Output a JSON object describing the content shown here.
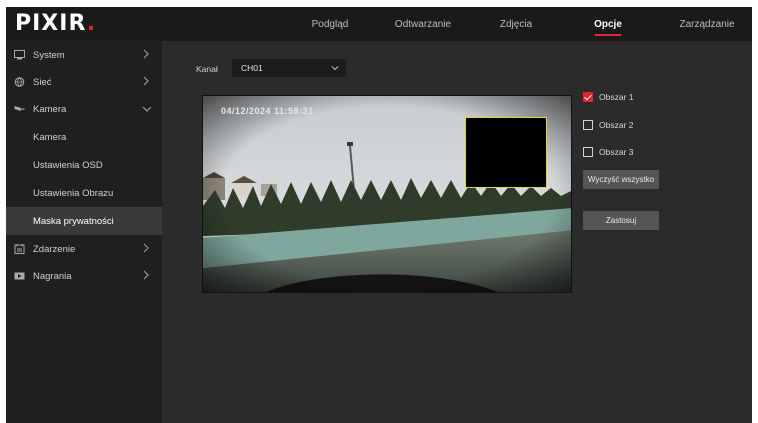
{
  "logo": {
    "text": "PIXIR",
    "accent": "#e8232a"
  },
  "nav": {
    "items": [
      {
        "label": "Podgląd",
        "active": false
      },
      {
        "label": "Odtwarzanie",
        "active": false
      },
      {
        "label": "Zdjęcia",
        "active": false
      },
      {
        "label": "Opcje",
        "active": true
      },
      {
        "label": "Zarządzanie",
        "active": false
      }
    ]
  },
  "sidebar": {
    "items": [
      {
        "label": "System",
        "icon": "system-icon",
        "expanded": false
      },
      {
        "label": "Sieć",
        "icon": "network-icon",
        "expanded": false
      },
      {
        "label": "Kamera",
        "icon": "camera-icon",
        "expanded": true
      },
      {
        "label": "Zdarzenie",
        "icon": "event-icon",
        "expanded": false
      },
      {
        "label": "Nagrania",
        "icon": "recording-icon",
        "expanded": false
      }
    ],
    "camera_sub": [
      {
        "label": "Kamera",
        "selected": false
      },
      {
        "label": "Ustawienia OSD",
        "selected": false
      },
      {
        "label": "Ustawienia Obrazu",
        "selected": false
      },
      {
        "label": "Maska prywatności",
        "selected": true
      }
    ]
  },
  "content": {
    "channel_label": "Kanał",
    "channel_value": "CH01",
    "osd_timestamp": "04/12/2024  11:58:31",
    "areas": [
      {
        "label": "Obszar 1",
        "checked": true
      },
      {
        "label": "Obszar 2",
        "checked": false
      },
      {
        "label": "Obszar 3",
        "checked": false
      }
    ],
    "clear_all_label": "Wyczyść wszystko",
    "apply_label": "Zastosuj"
  }
}
